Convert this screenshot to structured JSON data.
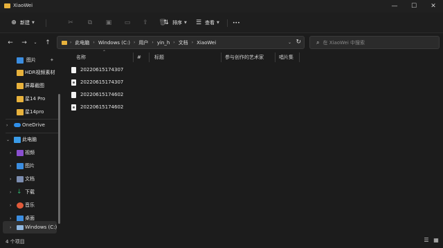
{
  "window": {
    "title": "XiaoWei",
    "minimize_glyph": "—",
    "maximize_glyph": "☐",
    "close_glyph": "✕"
  },
  "toolbar": {
    "new_label": "新建",
    "sort_label": "排序",
    "view_label": "查看",
    "more_glyph": "•••"
  },
  "address": {
    "segments": [
      "此电脑",
      "Windows (C:)",
      "用户",
      "yin_h",
      "文档",
      "XiaoWei"
    ]
  },
  "search": {
    "placeholder": "在 XiaoWei 中搜索"
  },
  "sidebar": {
    "quick_access": [
      {
        "label": "图片",
        "icon": "pictures-icon",
        "color": "#3b8de0",
        "pinned": true
      },
      {
        "label": "HDR视频素材",
        "icon": "folder-icon",
        "color": "#e8b23c"
      },
      {
        "label": "屏幕截图",
        "icon": "folder-icon",
        "color": "#e8b23c"
      },
      {
        "label": "星14 Pro",
        "icon": "folder-icon",
        "color": "#e8b23c"
      },
      {
        "label": "星14pro",
        "icon": "folder-icon",
        "color": "#e8b23c"
      }
    ],
    "onedrive": {
      "label": "OneDrive",
      "icon": "cloud-icon",
      "color": "#2f8ee8"
    },
    "this_pc": {
      "label": "此电脑",
      "icon": "computer-icon",
      "color": "#3a9be8"
    },
    "pc_items": [
      {
        "label": "视频",
        "icon": "videos-icon",
        "color": "#8a4fd0"
      },
      {
        "label": "图片",
        "icon": "pictures-icon",
        "color": "#3b8de0"
      },
      {
        "label": "文档",
        "icon": "documents-icon",
        "color": "#7c8db0"
      },
      {
        "label": "下载",
        "icon": "downloads-icon",
        "color": "#2fb36f"
      },
      {
        "label": "音乐",
        "icon": "music-icon",
        "color": "#e05a3a"
      },
      {
        "label": "桌面",
        "icon": "desktop-icon",
        "color": "#3b8de0"
      },
      {
        "label": "Windows (C:)",
        "icon": "drive-icon",
        "color": "#8fb7e0",
        "selected": true
      }
    ]
  },
  "columns": [
    {
      "label": "名称"
    },
    {
      "label": "#"
    },
    {
      "label": "标题"
    },
    {
      "label": "参与创作的艺术家"
    },
    {
      "label": "唱片集"
    }
  ],
  "files": [
    {
      "name": "20220615174307",
      "icon": "text-file-icon"
    },
    {
      "name": "20220615174307",
      "icon": "image-file-icon"
    },
    {
      "name": "20220615174602",
      "icon": "text-file-icon"
    },
    {
      "name": "20220615174602",
      "icon": "image-file-icon"
    }
  ],
  "status": {
    "item_count": "4 个项目"
  }
}
